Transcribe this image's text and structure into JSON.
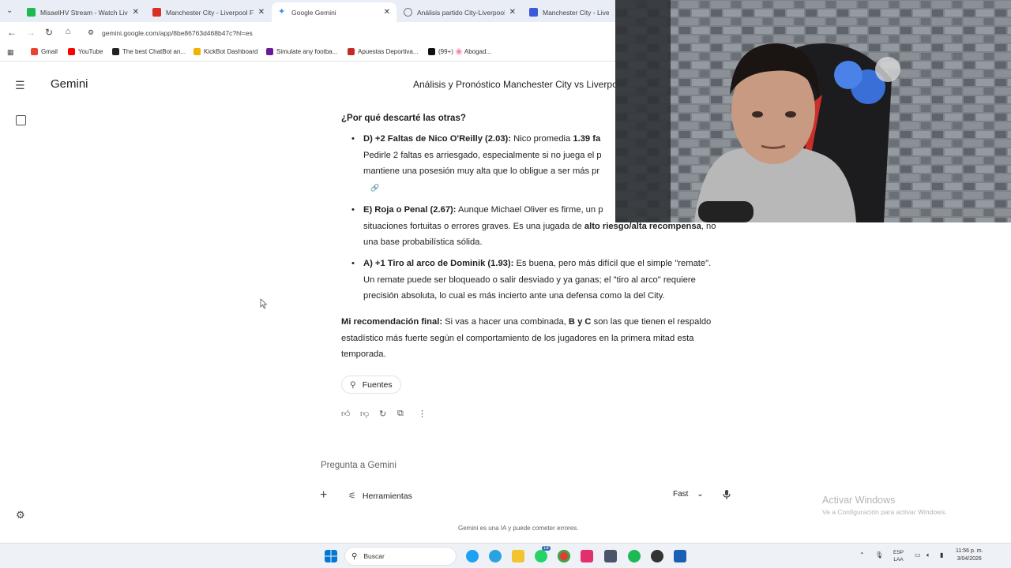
{
  "browser": {
    "tabs": [
      {
        "title": "MisaelHV Stream - Watch Live o",
        "color": "#1db954"
      },
      {
        "title": "Manchester City - Liverpool FC",
        "color": "#d93025"
      },
      {
        "title": "Google Gemini",
        "color": "#4285f4"
      },
      {
        "title": "Análisis partido City-Liverpool",
        "color": "#777777"
      },
      {
        "title": "Manchester City - Liverp",
        "color": "#3b5bdb"
      }
    ],
    "url": "gemini.google.com/app/8be86763d468b47c?hl=es",
    "bookmarks": [
      {
        "label": "Gmail",
        "color": "#ea4335"
      },
      {
        "label": "YouTube",
        "color": "#ff0000"
      },
      {
        "label": "The best ChatBot an...",
        "color": "#222222"
      },
      {
        "label": "KickBot Dashboard",
        "color": "#f2b300"
      },
      {
        "label": "Simulate any footba...",
        "color": "#6a1b9a"
      },
      {
        "label": "Apuestas Deportiva...",
        "color": "#c62828"
      },
      {
        "label": "(99+) 🌸 Abogad...",
        "color": "#111111"
      }
    ]
  },
  "app": {
    "title": "Gemini",
    "chat_title": "Análisis y Pronóstico Manchester City vs Liverpool",
    "heading": "¿Por qué descarté las otras?",
    "bullet_d": {
      "label": "D) +2 Faltas de Nico O'Reilly (2.03):",
      "text1": "Nico promedia",
      "bold1": "1.39 fa",
      "line2": "Pedirle 2 faltas es arriesgado, especialmente si no juega el p",
      "line3": "mantiene una posesión muy alta que lo obligue a ser más pr"
    },
    "bullet_e": {
      "label": "E) Roja o Penal (2.67):",
      "text1": "Aunque Michael Oliver es firme, un p",
      "line2a": "situaciones fortuitas o errores graves. Es una jugada de",
      "bold2": "alto riesgo/alta recompensa",
      "line2b": ", no",
      "line3": "una base probabilística sólida."
    },
    "bullet_a": {
      "label": "A) +1 Tiro al arco de Dominik (1.93):",
      "text1": "Es buena, pero más difícil que el simple \"remate\".",
      "line2": "Un remate puede ser bloqueado o salir desviado y ya ganas; el \"tiro al arco\" requiere",
      "line3": "precisión absoluta, lo cual es más incierto ante una defensa como la del City."
    },
    "final": {
      "label": "Mi recomendación final:",
      "text1": "Si vas a hacer una combinada,",
      "bold": "B y C",
      "text2": "son las que tienen el respaldo",
      "line2": "estadístico más fuerte según el comportamiento de los jugadores en la primera mitad esta",
      "line3": "temporada."
    },
    "sources_label": "Fuentes",
    "prompt_placeholder": "Pregunta a Gemini",
    "tools_label": "Herramientas",
    "model_label": "Fast",
    "disclaimer": "Gemini es una IA y puede cometer errores."
  },
  "windows": {
    "activate_title": "Activar Windows",
    "activate_sub": "Ve a Configuración para activar Windows.",
    "search_label": "Buscar",
    "lang_top": "ESP",
    "lang_bottom": "LAA",
    "time": "11:56 p. m.",
    "date": "3/04/2026",
    "whatsapp_badge": "18"
  }
}
